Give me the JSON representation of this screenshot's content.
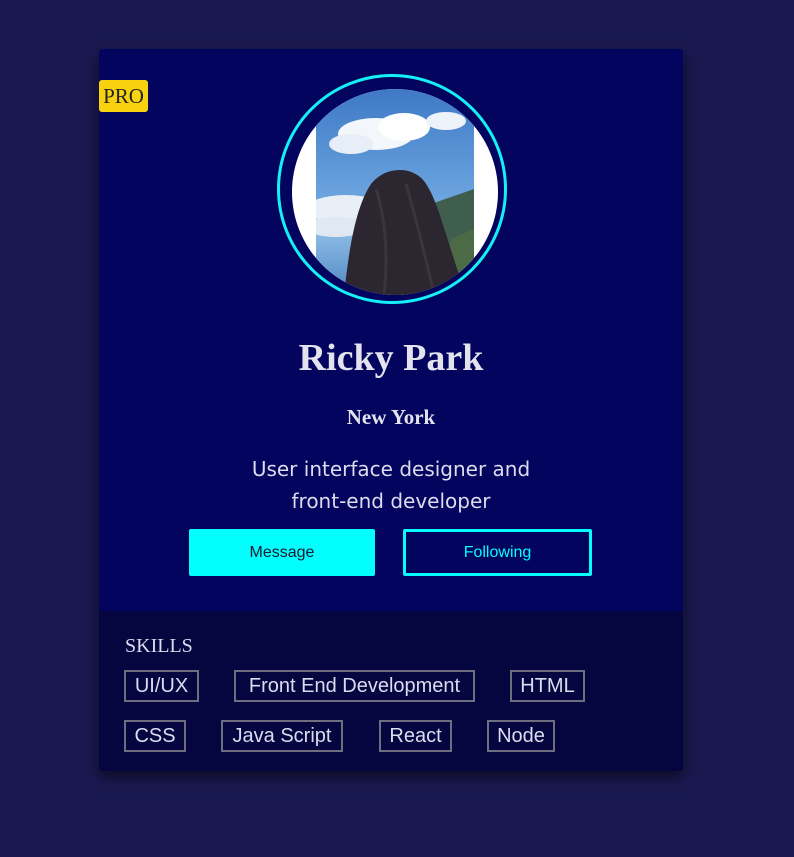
{
  "profile": {
    "badge": "PRO",
    "name": "Ricky Park",
    "location": "New York",
    "bio_line1": "User interface designer and",
    "bio_line2": "front-end developer"
  },
  "actions": {
    "message_label": "Message",
    "following_label": "Following"
  },
  "skills": {
    "title": "SKILLS",
    "items": [
      "UI/UX",
      "Front End Development",
      "HTML",
      "CSS",
      "Java Script",
      "React",
      "Node"
    ]
  },
  "colors": {
    "page_background": "#191950",
    "card_background": "#03045e",
    "skills_background": "#050640",
    "accent_cyan": "#03fefe",
    "badge_yellow": "#f8d20e"
  }
}
